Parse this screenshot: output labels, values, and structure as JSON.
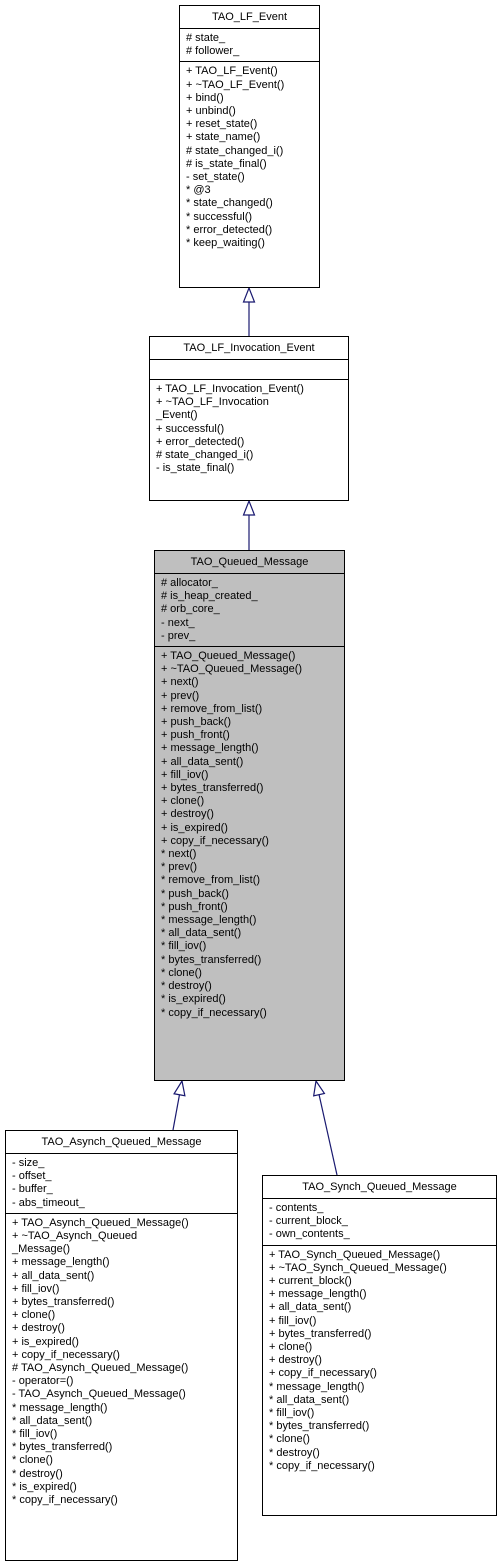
{
  "diagram": {
    "classes": [
      {
        "name": "TAO_LF_Event",
        "attributes": [
          "# state_",
          "# follower_"
        ],
        "methods": [
          "+ TAO_LF_Event()",
          "+ ~TAO_LF_Event()",
          "+ bind()",
          "+ unbind()",
          "+ reset_state()",
          "+ state_name()",
          "# state_changed_i()",
          "# is_state_final()",
          "- set_state()",
          "* @3",
          "* state_changed()",
          "* successful()",
          "* error_detected()",
          "* keep_waiting()"
        ]
      },
      {
        "name": "TAO_LF_Invocation_Event",
        "attributes": [],
        "methods": [
          "+ TAO_LF_Invocation_Event()",
          "+ ~TAO_LF_Invocation",
          "_Event()",
          "+ successful()",
          "+ error_detected()",
          "# state_changed_i()",
          "- is_state_final()"
        ]
      },
      {
        "name": "TAO_Queued_Message",
        "highlighted": true,
        "attributes": [
          "# allocator_",
          "# is_heap_created_",
          "# orb_core_",
          "- next_",
          "- prev_"
        ],
        "methods": [
          "+ TAO_Queued_Message()",
          "+ ~TAO_Queued_Message()",
          "+ next()",
          "+ prev()",
          "+ remove_from_list()",
          "+ push_back()",
          "+ push_front()",
          "+ message_length()",
          "+ all_data_sent()",
          "+ fill_iov()",
          "+ bytes_transferred()",
          "+ clone()",
          "+ destroy()",
          "+ is_expired()",
          "+ copy_if_necessary()",
          "* next()",
          "* prev()",
          "* remove_from_list()",
          "* push_back()",
          "* push_front()",
          "* message_length()",
          "* all_data_sent()",
          "* fill_iov()",
          "* bytes_transferred()",
          "* clone()",
          "* destroy()",
          "* is_expired()",
          "* copy_if_necessary()"
        ]
      },
      {
        "name": "TAO_Asynch_Queued_Message",
        "attributes": [
          "- size_",
          "- offset_",
          "- buffer_",
          "- abs_timeout_"
        ],
        "methods": [
          "+ TAO_Asynch_Queued_Message()",
          "+ ~TAO_Asynch_Queued",
          "_Message()",
          "+ message_length()",
          "+ all_data_sent()",
          "+ fill_iov()",
          "+ bytes_transferred()",
          "+ clone()",
          "+ destroy()",
          "+ is_expired()",
          "+ copy_if_necessary()",
          "# TAO_Asynch_Queued_Message()",
          "- operator=()",
          "- TAO_Asynch_Queued_Message()",
          "* message_length()",
          "* all_data_sent()",
          "* fill_iov()",
          "* bytes_transferred()",
          "* clone()",
          "* destroy()",
          "* is_expired()",
          "* copy_if_necessary()"
        ]
      },
      {
        "name": "TAO_Synch_Queued_Message",
        "attributes": [
          "- contents_",
          "- current_block_",
          "- own_contents_"
        ],
        "methods": [
          "+ TAO_Synch_Queued_Message()",
          "+ ~TAO_Synch_Queued_Message()",
          "+ current_block()",
          "+ message_length()",
          "+ all_data_sent()",
          "+ fill_iov()",
          "+ bytes_transferred()",
          "+ clone()",
          "+ destroy()",
          "+ copy_if_necessary()",
          "* message_length()",
          "* all_data_sent()",
          "* fill_iov()",
          "* bytes_transferred()",
          "* clone()",
          "* destroy()",
          "* copy_if_necessary()"
        ]
      }
    ],
    "inheritance": [
      {
        "from": "TAO_LF_Invocation_Event",
        "to": "TAO_LF_Event"
      },
      {
        "from": "TAO_Queued_Message",
        "to": "TAO_LF_Invocation_Event"
      },
      {
        "from": "TAO_Asynch_Queued_Message",
        "to": "TAO_Queued_Message"
      },
      {
        "from": "TAO_Synch_Queued_Message",
        "to": "TAO_Queued_Message"
      }
    ],
    "colors": {
      "edge": "#191970",
      "highlight_fill": "#bfbfbf",
      "box_border": "#000000"
    }
  }
}
